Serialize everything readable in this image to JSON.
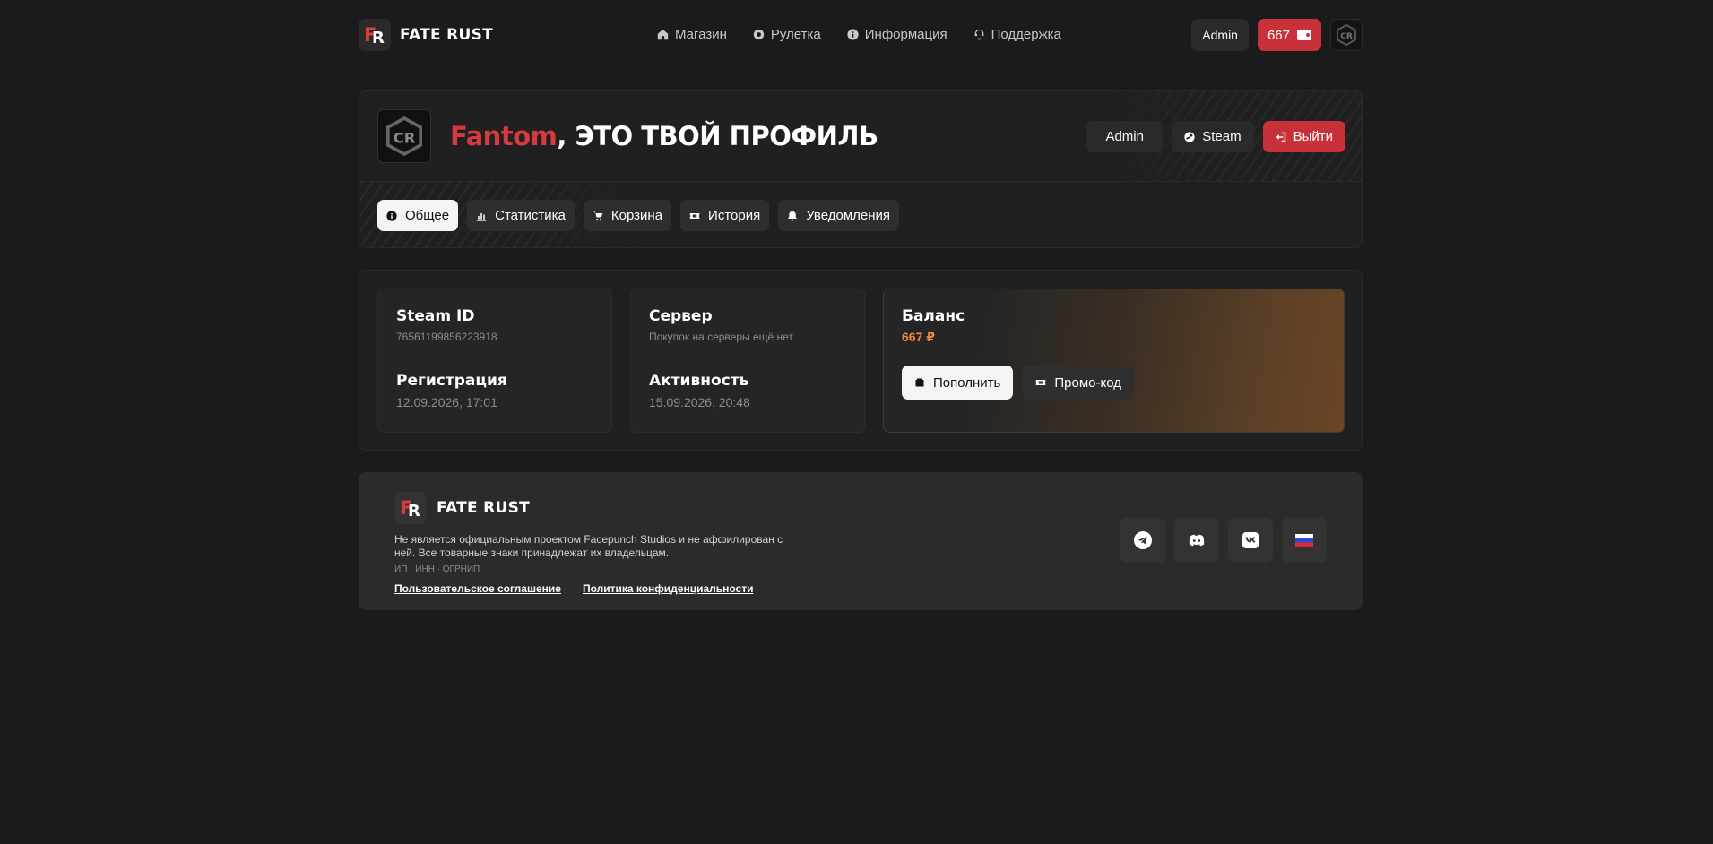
{
  "header": {
    "brand": "FATE RUST",
    "nav": [
      {
        "label": "Магазин",
        "icon": "home-icon"
      },
      {
        "label": "Рулетка",
        "icon": "roulette-icon"
      },
      {
        "label": "Информация",
        "icon": "info-icon"
      },
      {
        "label": "Поддержка",
        "icon": "support-icon"
      }
    ],
    "admin_label": "Admin",
    "balance": "667"
  },
  "profile": {
    "username": "Fantom",
    "title_suffix": ", ЭТО ТВОЙ ПРОФИЛЬ",
    "actions": {
      "admin": "Admin",
      "steam": "Steam",
      "logout": "Выйти"
    },
    "tabs": [
      {
        "label": "Общее",
        "active": true
      },
      {
        "label": "Статистика",
        "active": false
      },
      {
        "label": "Корзина",
        "active": false
      },
      {
        "label": "История",
        "active": false
      },
      {
        "label": "Уведомления",
        "active": false
      }
    ]
  },
  "info": {
    "steam_id_label": "Steam ID",
    "steam_id": "76561199856223918",
    "registration_label": "Регистрация",
    "registration": "12.09.2026, 17:01",
    "server_label": "Сервер",
    "server": "Покупок на серверы ещё нет",
    "activity_label": "Активность",
    "activity": "15.09.2026, 20:48",
    "balance_label": "Баланс",
    "balance": "667 ₽",
    "topup_label": "Пополнить",
    "promo_label": "Промо-код"
  },
  "footer": {
    "brand": "FATE RUST",
    "description": "Не является официальным проектом Facepunch Studios и не аффилирован с ней. Все товарные знаки принадлежат их владельцам.",
    "legal": "ИП · ИНН · ОГРНИП",
    "links": [
      "Пользовательское соглашение",
      "Политика конфиденциальности"
    ]
  },
  "colors": {
    "background": "#1b1b1b",
    "accent_red": "#c8303a",
    "accent_orange": "#f08a3c"
  }
}
